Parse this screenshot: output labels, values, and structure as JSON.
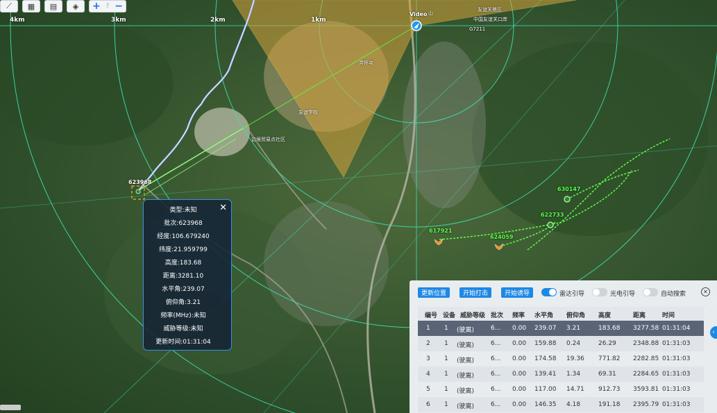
{
  "toolbar": {
    "buttons": [
      {
        "icon": "ruler-icon",
        "glyph": "⟋"
      },
      {
        "icon": "map-view-icon",
        "glyph": "▦"
      },
      {
        "icon": "grid-icon",
        "glyph": "▤"
      },
      {
        "icon": "layers-icon",
        "glyph": "◈"
      }
    ],
    "zoom_in": "+",
    "zoom_sep": "?",
    "zoom_out": "−"
  },
  "map": {
    "scale_labels": [
      "4km",
      "3km",
      "2km",
      "1km"
    ],
    "place_labels": {
      "top_area": "友谊关景区",
      "port": "中国友谊关口岸",
      "road": "G7211",
      "school": "友谊学校",
      "community": "边境贸易点社区",
      "village": "弄怀屯",
      "shan": "山"
    },
    "video_tag": "Video",
    "selected_target_label": "623968",
    "track_labels": [
      "630147",
      "622733",
      "617921",
      "624059"
    ]
  },
  "popup": {
    "type": "类型:未知",
    "batch": "批次:623968",
    "lon": "经度:106.679240",
    "lat": "纬度:21.959799",
    "alt": "高度:183.68",
    "dist": "距离:3281.10",
    "az": "水平角:239.07",
    "el": "俯仰角:3.21",
    "freq": "频率(MHz):未知",
    "threat": "威胁等级:未知",
    "updated": "更新时间:01:31:04",
    "close": "✕"
  },
  "panel": {
    "buttons": [
      "更新位置",
      "开始打击",
      "开始诱导"
    ],
    "toggles": [
      {
        "label": "雷达引导",
        "on": true
      },
      {
        "label": "光电引导",
        "on": false
      },
      {
        "label": "自动搜索",
        "on": false
      }
    ],
    "close": "✕",
    "side_tab": "‹",
    "columns": [
      "编号",
      "设备",
      "威胁等级",
      "批次",
      "频率",
      "水平角",
      "俯仰角",
      "高度",
      "距离",
      "时间"
    ],
    "rows": [
      [
        "1",
        "1",
        "(驶离)",
        "6...",
        "0.00",
        "239.07",
        "3.21",
        "183.68",
        "3277.58",
        "01:31:04"
      ],
      [
        "2",
        "1",
        "(驶离)",
        "6...",
        "0.00",
        "159.88",
        "0.24",
        "26.29",
        "2348.88",
        "01:31:03"
      ],
      [
        "3",
        "1",
        "(驶离)",
        "6...",
        "0.00",
        "174.58",
        "19.36",
        "771.82",
        "2282.85",
        "01:31:03"
      ],
      [
        "4",
        "1",
        "(驶离)",
        "6...",
        "0.00",
        "139.41",
        "1.34",
        "69.31",
        "2284.65",
        "01:31:03"
      ],
      [
        "5",
        "1",
        "(驶离)",
        "6...",
        "0.00",
        "117.00",
        "14.71",
        "912.73",
        "3593.81",
        "01:31:03"
      ],
      [
        "6",
        "1",
        "(驶离)",
        "6...",
        "0.00",
        "146.35",
        "4.18",
        "191.18",
        "2395.79",
        "01:31:03"
      ]
    ],
    "selected_row": 0
  },
  "colors": {
    "accent": "#1e88e5",
    "track": "#5cff4a",
    "sector": "#d6a23c",
    "ring": "#3fe0b0"
  }
}
